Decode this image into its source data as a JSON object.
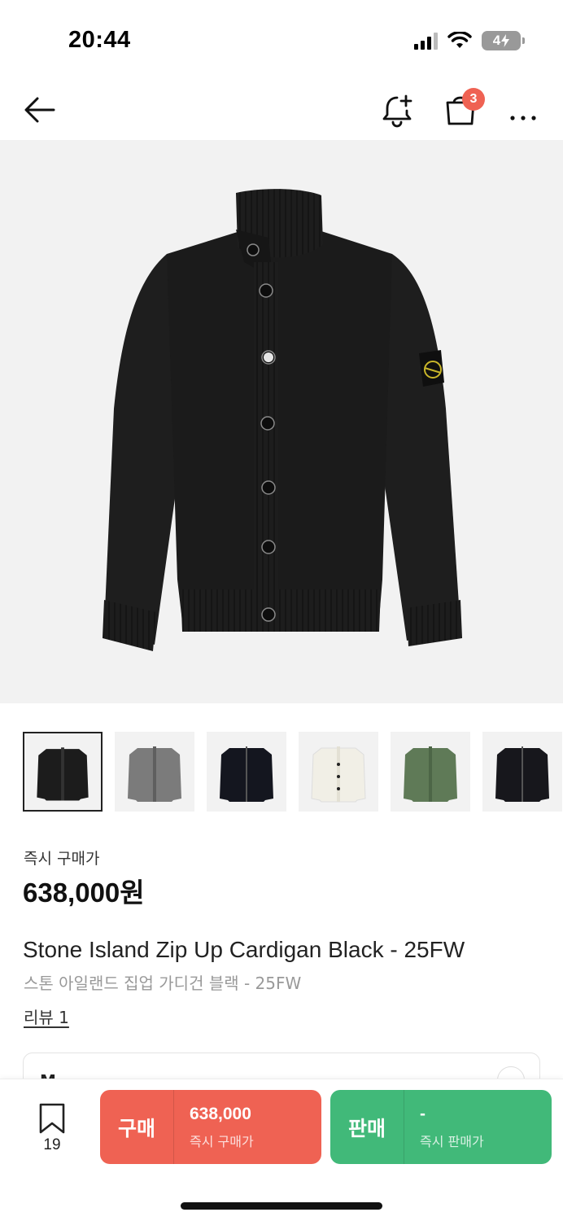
{
  "status_bar": {
    "time": "20:44",
    "battery": "4"
  },
  "nav": {
    "cart_badge": "3"
  },
  "product": {
    "price_label": "즉시 구매가",
    "price": "638,000원",
    "title_en": "Stone Island Zip Up Cardigan Black - 25FW",
    "title_ko": "스톤 아일랜드 집업 가디건 블랙 - 25FW",
    "review": "리뷰 1",
    "size": "M"
  },
  "thumbnails": [
    {
      "color": "#1c1c1c"
    },
    {
      "color": "#7b7b7b"
    },
    {
      "color": "#14161f"
    },
    {
      "color": "#f1efe6"
    },
    {
      "color": "#5f7a57"
    },
    {
      "color": "#17171c"
    }
  ],
  "bottom_bar": {
    "bookmark_count": "19",
    "buy": {
      "label": "구매",
      "price": "638,000",
      "sub": "즉시 구매가"
    },
    "sell": {
      "label": "판매",
      "price": "-",
      "sub": "즉시 판매가"
    }
  },
  "colors": {
    "buy": "#ef6253",
    "sell": "#41b979",
    "badge": "#ef6253"
  }
}
